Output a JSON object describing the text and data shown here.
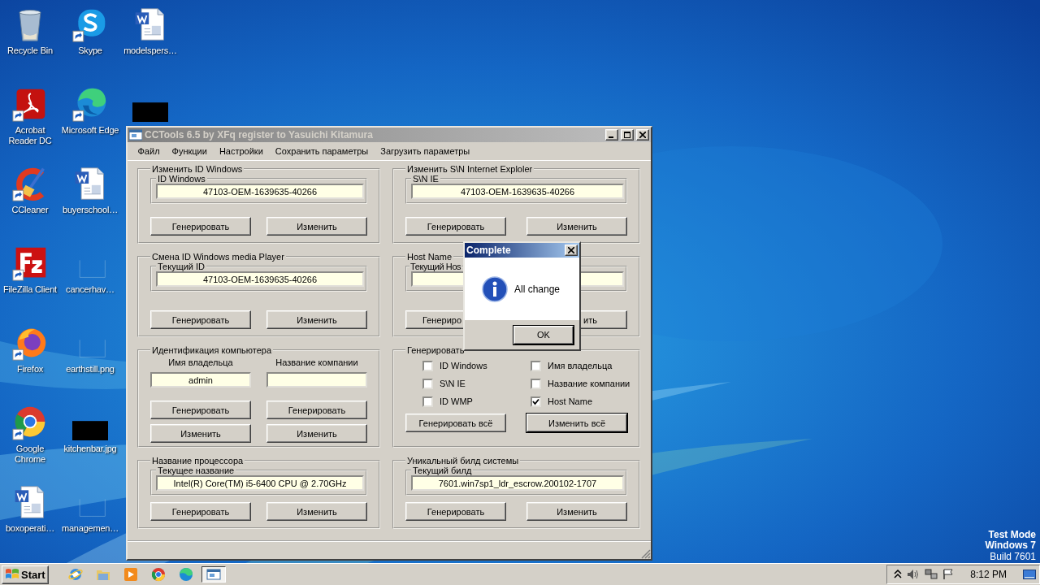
{
  "desktop": {
    "icons": [
      {
        "kind": "recycle_bin",
        "label": "Recycle Bin",
        "shortcut": false
      },
      {
        "kind": "pdf_reader",
        "label": "Acrobat Reader DC",
        "shortcut": true
      },
      {
        "kind": "cleaner",
        "label": "CCleaner",
        "shortcut": true
      },
      {
        "kind": "ftp_client",
        "label": "FileZilla Client",
        "shortcut": true
      },
      {
        "kind": "firefox",
        "label": "Firefox",
        "shortcut": true
      },
      {
        "kind": "chrome",
        "label": "Google Chrome",
        "shortcut": true
      },
      {
        "kind": "word_doc",
        "label": "boxoperati…",
        "shortcut": false
      },
      {
        "kind": "skype",
        "label": "Skype",
        "shortcut": true
      },
      {
        "kind": "edge",
        "label": "Microsoft Edge",
        "shortcut": true
      },
      {
        "kind": "word_doc",
        "label": "buyerschool…",
        "shortcut": false
      },
      {
        "kind": "blank_file",
        "label": "cancerhav…",
        "shortcut": false
      },
      {
        "kind": "blank_file",
        "label": "earthstill.png",
        "shortcut": false
      },
      {
        "kind": "dark_thumbnail",
        "label": "kitchenbar.jpg",
        "shortcut": false
      },
      {
        "kind": "blank_file",
        "label": "managemen…",
        "shortcut": false
      },
      {
        "kind": "word_doc",
        "label": "modelspers…",
        "shortcut": false
      },
      {
        "kind": "dark_thumbnail",
        "shortcut": false
      }
    ],
    "system_notice": [
      "Test Mode",
      "Windows 7",
      "Build 7601"
    ]
  },
  "window": {
    "title": "CCTools 6.5 by XFq register to Yasuichi Kitamura",
    "menu": [
      "Файл",
      "Функции",
      "Настройки",
      "Сохранить параметры",
      "Загрузить параметры"
    ],
    "groups": [
      {
        "kind": "field",
        "title": "Изменить ID Windows",
        "field_label": "ID Windows",
        "value": "47103-OEM-1639635-40266",
        "buttons": [
          "Генерировать",
          "Изменить"
        ]
      },
      {
        "kind": "field",
        "title": "Изменить S\\N Internet Exploler",
        "field_label": "S\\N IE",
        "value": "47103-OEM-1639635-40266",
        "buttons": [
          "Генерировать",
          "Изменить"
        ]
      },
      {
        "kind": "field",
        "title": "Смена ID Windows media Player",
        "field_label": "Текущий ID",
        "value": "47103-OEM-1639635-40266",
        "buttons": [
          "Генерировать",
          "Изменить"
        ]
      },
      {
        "kind": "covered",
        "title": "Host Name",
        "field_label": "Текущий Hos",
        "buttons": [
          "Генериро",
          "ить"
        ]
      },
      {
        "kind": "identity",
        "title": "Идентификация компьютера",
        "columns": [
          {
            "label": "Имя владельца",
            "value": "admin",
            "buttons": [
              "Генерировать",
              "Изменить"
            ]
          },
          {
            "label": "Название компании",
            "buttons": [
              "Генерировать",
              "Изменить"
            ]
          }
        ]
      },
      {
        "kind": "checks",
        "title": "Генерировать",
        "checkboxes": [
          {
            "label": "ID Windows",
            "checked": false
          },
          {
            "label": "Имя владельца",
            "checked": false
          },
          {
            "label": "S\\N IE",
            "checked": false
          },
          {
            "label": "Название компании",
            "checked": false
          },
          {
            "label": "ID WMP",
            "checked": false
          },
          {
            "label": "Host Name",
            "checked": true
          }
        ],
        "buttons": [
          {
            "label": "Генерировать всё",
            "default": false
          },
          {
            "label": "Изменить всё",
            "default": true
          }
        ]
      },
      {
        "kind": "field",
        "title": "Название процессора",
        "field_label": "Текущее название",
        "value": "Intel(R) Core(TM) i5-6400 CPU @ 2.70GHz",
        "buttons": [
          "Генерировать",
          "Изменить"
        ]
      },
      {
        "kind": "field",
        "title": "Уникальный билд системы",
        "field_label": "Текущий билд",
        "value": "7601.win7sp1_ldr_escrow.200102-1707",
        "buttons": [
          "Генерировать",
          "Изменить"
        ]
      }
    ]
  },
  "dialog": {
    "title": "Complete",
    "message": "All change",
    "button": "OK"
  },
  "taskbar": {
    "start": "Start",
    "apps": [
      {
        "kind": "ie",
        "active": false
      },
      {
        "kind": "explorer",
        "active": false
      },
      {
        "kind": "media",
        "active": false
      },
      {
        "kind": "chrome",
        "active": false
      },
      {
        "kind": "edge",
        "active": false
      },
      {
        "kind": "cctools",
        "active": true
      }
    ],
    "clock": "8:12 PM"
  }
}
